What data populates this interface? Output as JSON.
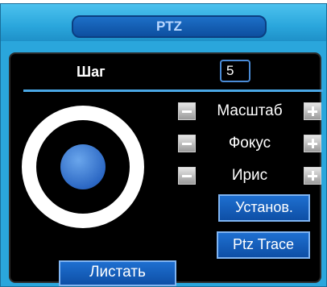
{
  "window": {
    "title": "PTZ"
  },
  "step": {
    "label": "Шаг",
    "value": "5"
  },
  "controls": [
    {
      "label": "Масштаб"
    },
    {
      "label": "Фокус"
    },
    {
      "label": "Ирис"
    }
  ],
  "buttons": {
    "set": "Установ.",
    "ptz_trace": "Ptz Trace",
    "page": "Листать"
  },
  "colors": {
    "frame": "#2aa6dc",
    "button": "#1e6fd0",
    "panel": "#000000"
  }
}
